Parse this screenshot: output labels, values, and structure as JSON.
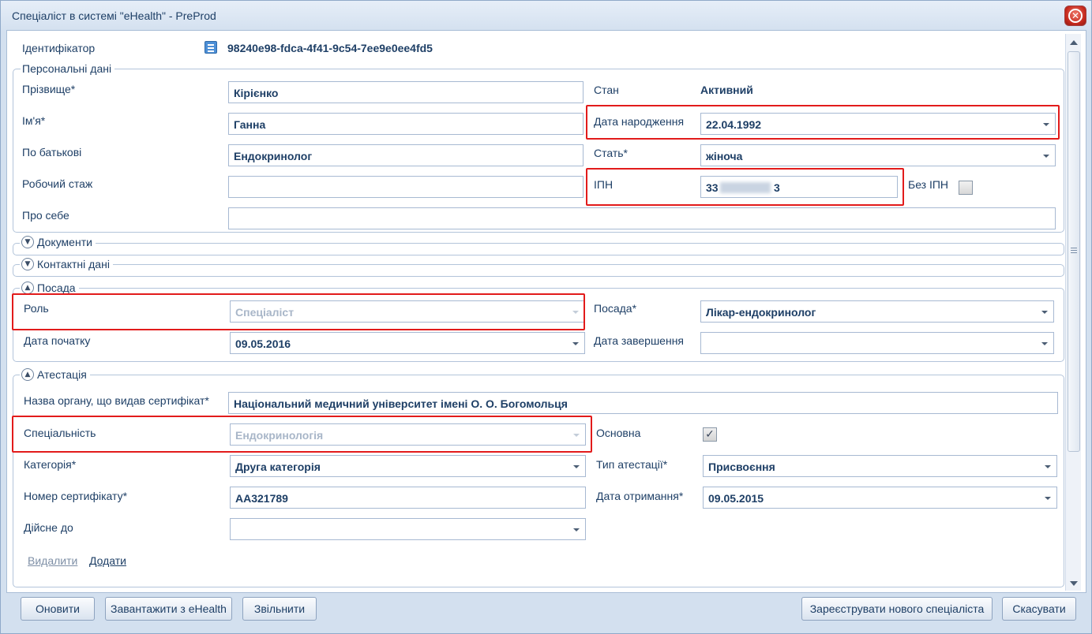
{
  "window": {
    "title": "Спеціаліст в системі \"eHealth\" - PreProd"
  },
  "identifier": {
    "label": "Ідентифікатор",
    "value": "98240e98-fdca-4f41-9c54-7ee9e0ee4fd5"
  },
  "personal": {
    "legend": "Персональні дані",
    "surname_label": "Прізвище*",
    "surname_value": "Кірієнко",
    "name_label": "Ім'я*",
    "name_value": "Ганна",
    "patronymic_label": "По батькові",
    "patronymic_value": "Ендокринолог",
    "experience_label": "Робочий стаж",
    "experience_value": "",
    "about_label": "Про себе",
    "about_value": "",
    "status_label": "Стан",
    "status_value": "Активний",
    "birth_label": "Дата народження",
    "birth_value": "22.04.1992",
    "gender_label": "Стать*",
    "gender_value": "жіноча",
    "ipn_label": "ІПН",
    "ipn_value_start": "33",
    "ipn_value_end": "3",
    "no_ipn_label": "Без ІПН"
  },
  "documents": {
    "legend": "Документи"
  },
  "contacts": {
    "legend": "Контактні дані"
  },
  "position": {
    "legend": "Посада",
    "role_label": "Роль",
    "role_value": "Спеціаліст",
    "start_label": "Дата початку",
    "start_value": "09.05.2016",
    "post_label": "Посада*",
    "post_value": "Лікар-ендокринолог",
    "end_label": "Дата завершення",
    "end_value": ""
  },
  "attestation": {
    "legend": "Атестація",
    "issuer_label": "Назва органу, що видав сертифікат*",
    "issuer_value": "Національний медичний університет імені О. О. Богомольця",
    "specialty_label": "Спеціальність",
    "specialty_value": "Ендокринологія",
    "main_label": "Основна",
    "category_label": "Категорія*",
    "category_value": "Друга категорія",
    "type_label": "Тип атестації*",
    "type_value": "Присвоєння",
    "cert_label": "Номер сертифікату*",
    "cert_value": "АА321789",
    "received_label": "Дата отримання*",
    "received_value": "09.05.2015",
    "valid_label": "Дійсне до",
    "valid_value": "",
    "delete_link": "Видалити",
    "add_link": "Додати"
  },
  "buttons": {
    "refresh": "Оновити",
    "load": "Завантажити з eHealth",
    "dismiss": "Звільнити",
    "register": "Зареєструвати нового спеціаліста",
    "cancel": "Скасувати"
  },
  "colors": {
    "highlight": "#e21b1b",
    "text": "#1e3f66",
    "border": "#a7b9d2"
  }
}
